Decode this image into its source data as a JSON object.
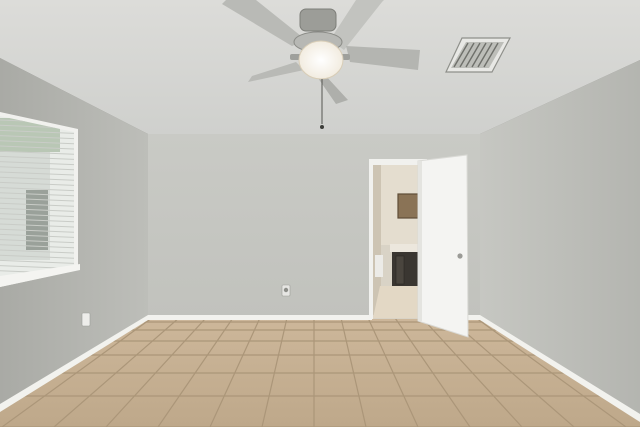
{
  "scene": {
    "subject": "empty-bedroom-interior",
    "colors": {
      "ceiling": "#d8d9d6",
      "back_wall": "#c6c7c2",
      "left_wall": "#b6b7b2",
      "right_wall": "#bfc0bb",
      "baseboard": "#f2f2ee",
      "floor_tile": "#c7b296",
      "grout": "#a89478",
      "door": "#f4f4f2",
      "window_light": "#eef2ee"
    },
    "elements": [
      "ceiling-fan",
      "ceiling-vent",
      "window-with-blinds",
      "open-door",
      "bathroom-vanity",
      "bathroom-mirror",
      "wall-outlet",
      "tile-floor"
    ]
  }
}
